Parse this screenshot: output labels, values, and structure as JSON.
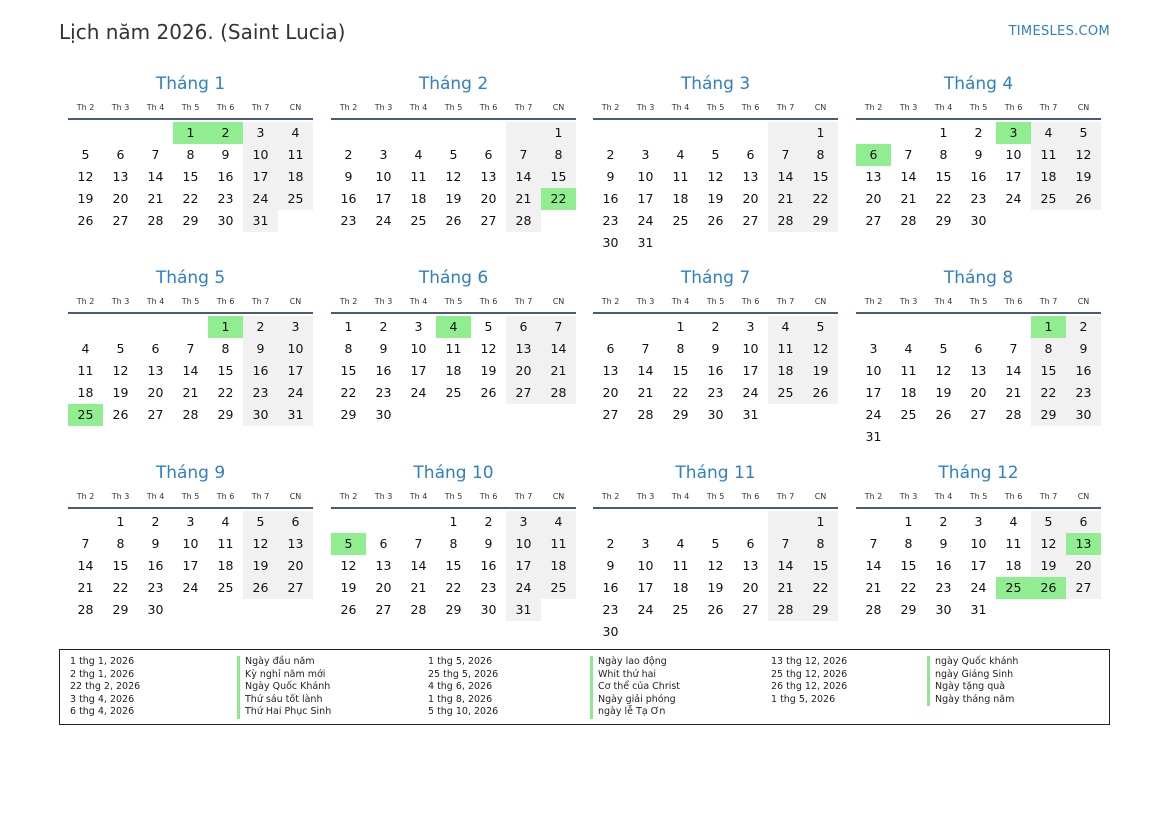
{
  "header": {
    "title": "Lịch năm 2026. (Saint Lucia)",
    "site": "TIMESLES.COM"
  },
  "weekdays": [
    "Th 2",
    "Th 3",
    "Th 4",
    "Th 5",
    "Th 6",
    "Th 7",
    "CN"
  ],
  "months": [
    {
      "name": "Tháng 1",
      "offset": 3,
      "days": 31,
      "holidays": [
        1,
        2
      ]
    },
    {
      "name": "Tháng 2",
      "offset": 6,
      "days": 28,
      "holidays": [
        22
      ]
    },
    {
      "name": "Tháng 3",
      "offset": 6,
      "days": 31,
      "holidays": []
    },
    {
      "name": "Tháng 4",
      "offset": 2,
      "days": 30,
      "holidays": [
        3,
        6
      ]
    },
    {
      "name": "Tháng 5",
      "offset": 4,
      "days": 31,
      "holidays": [
        1,
        25
      ]
    },
    {
      "name": "Tháng 6",
      "offset": 0,
      "days": 30,
      "holidays": [
        4
      ]
    },
    {
      "name": "Tháng 7",
      "offset": 2,
      "days": 31,
      "holidays": []
    },
    {
      "name": "Tháng 8",
      "offset": 5,
      "days": 31,
      "holidays": [
        1
      ]
    },
    {
      "name": "Tháng 9",
      "offset": 1,
      "days": 30,
      "holidays": []
    },
    {
      "name": "Tháng 10",
      "offset": 3,
      "days": 31,
      "holidays": [
        5
      ]
    },
    {
      "name": "Tháng 11",
      "offset": 6,
      "days": 30,
      "holidays": []
    },
    {
      "name": "Tháng 12",
      "offset": 1,
      "days": 31,
      "holidays": [
        13,
        25,
        26
      ]
    }
  ],
  "holiday_list": {
    "col1": {
      "dates": [
        "1 thg 1, 2026",
        "2 thg 1, 2026",
        "22 thg 2, 2026",
        "3 thg 4, 2026",
        "6 thg 4, 2026"
      ],
      "names": [
        "Ngày đầu năm",
        "Kỳ nghỉ năm mới",
        "Ngày Quốc Khánh",
        "Thứ sáu tốt lành",
        "Thứ Hai Phục Sinh"
      ]
    },
    "col2": {
      "dates": [
        "1 thg 5, 2026",
        "25 thg 5, 2026",
        "4 thg 6, 2026",
        "1 thg 8, 2026",
        "5 thg 10, 2026"
      ],
      "names": [
        "Ngày lao động",
        "Whit thứ hai",
        "Cơ thể của Christ",
        "Ngày giải phóng",
        "ngày lễ Tạ Ơn"
      ]
    },
    "col3": {
      "dates": [
        "13 thg 12, 2026",
        "25 thg 12, 2026",
        "26 thg 12, 2026",
        "1 thg 5, 2026"
      ],
      "names": [
        "ngày Quốc khánh",
        "ngày Giáng Sinh",
        "Ngày tặng quà",
        "Ngày tháng năm"
      ]
    }
  }
}
